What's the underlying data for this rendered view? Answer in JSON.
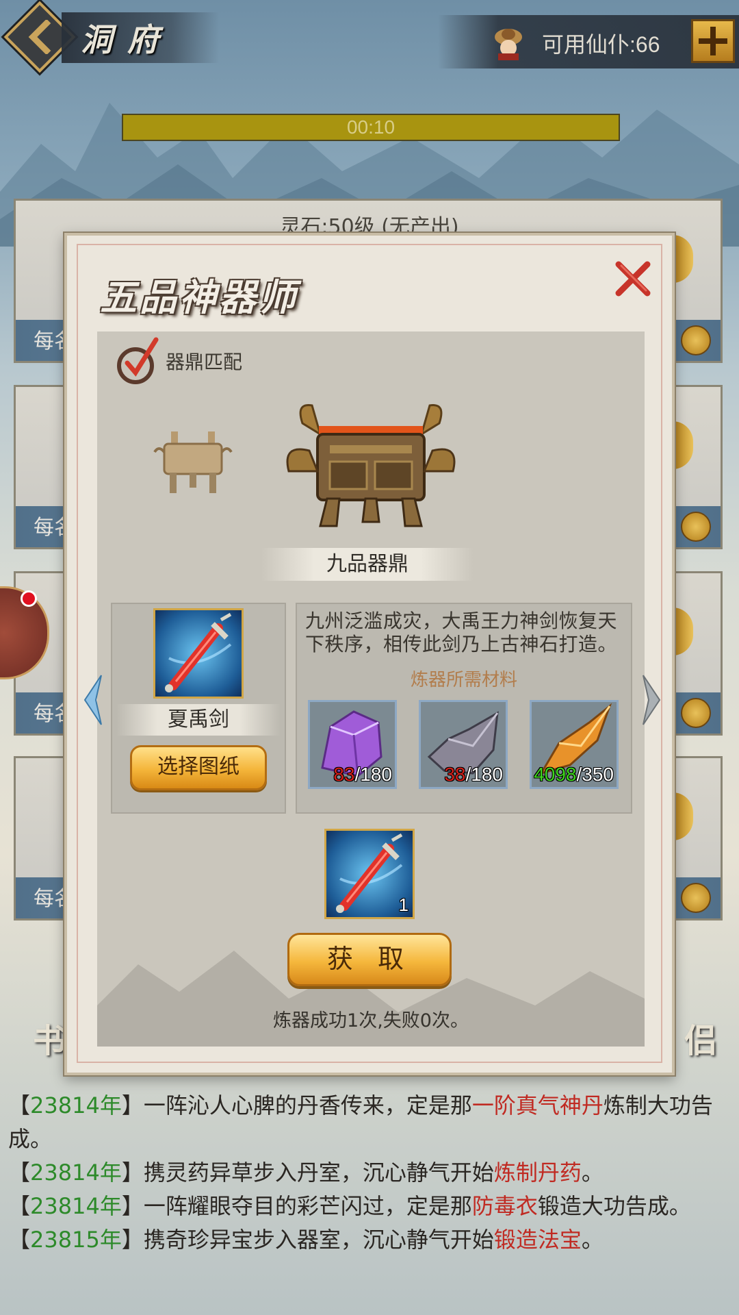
{
  "header": {
    "title": "洞府",
    "servants_text": "可用仙仆:66"
  },
  "timer": {
    "text": "00:10",
    "progress": 1.0
  },
  "background": {
    "stone_label": "灵石:50级 (无产出)",
    "card_labels": [
      "每名",
      "每名",
      "每名",
      "每名"
    ],
    "side_left_char": "书",
    "side_right_char": "侣"
  },
  "modal": {
    "title": "五品神器师",
    "match_label": "器鼎匹配",
    "cauldron_name": "九品器鼎",
    "blueprint": {
      "name": "夏禹剑",
      "select_label": "选择图纸"
    },
    "description": "九州泛滥成灾，大禹王力神剑恢复天下秩序，相传此剑乃上古神石打造。",
    "materials_title": "炼器所需材料",
    "materials": [
      {
        "icon": "purple-crystal-icon",
        "have": "83",
        "need": "/180",
        "have_color": "#d8201a"
      },
      {
        "icon": "grey-ore-icon",
        "have": "38",
        "need": "/180",
        "have_color": "#d8201a"
      },
      {
        "icon": "amber-crystal-icon",
        "have": "4098",
        "need": "/350",
        "have_color": "#3fd81e"
      }
    ],
    "result_qty": "1",
    "obtain_label": "获 取",
    "stats": "炼器成功1次,失败0次。"
  },
  "log": [
    {
      "b1": "【",
      "year": "23814年",
      "b2": "】",
      "pre": "一阵沁人心脾的丹香传来，定是那",
      "hl": "一阶真气神丹",
      "post": "炼制大功告成。"
    },
    {
      "b1": "【",
      "year": "23814年",
      "b2": "】",
      "pre": "携灵药异草步入丹室，沉心静气开始",
      "hl": "炼制丹药",
      "post": "。"
    },
    {
      "b1": "【",
      "year": "23814年",
      "b2": "】",
      "pre": "一阵耀眼夺目的彩芒闪过，定是那",
      "hl": "防毒衣",
      "post": "锻造大功告成。"
    },
    {
      "b1": "【",
      "year": "23815年",
      "b2": "】",
      "pre": "携奇珍异宝步入器室，沉心静气开始",
      "hl": "锻造法宝",
      "post": "。"
    }
  ],
  "colors": {
    "year": "#2d8a2a",
    "highlight": "#c02a22",
    "timer": "#a89410",
    "button_gold": "#f4b53a"
  }
}
